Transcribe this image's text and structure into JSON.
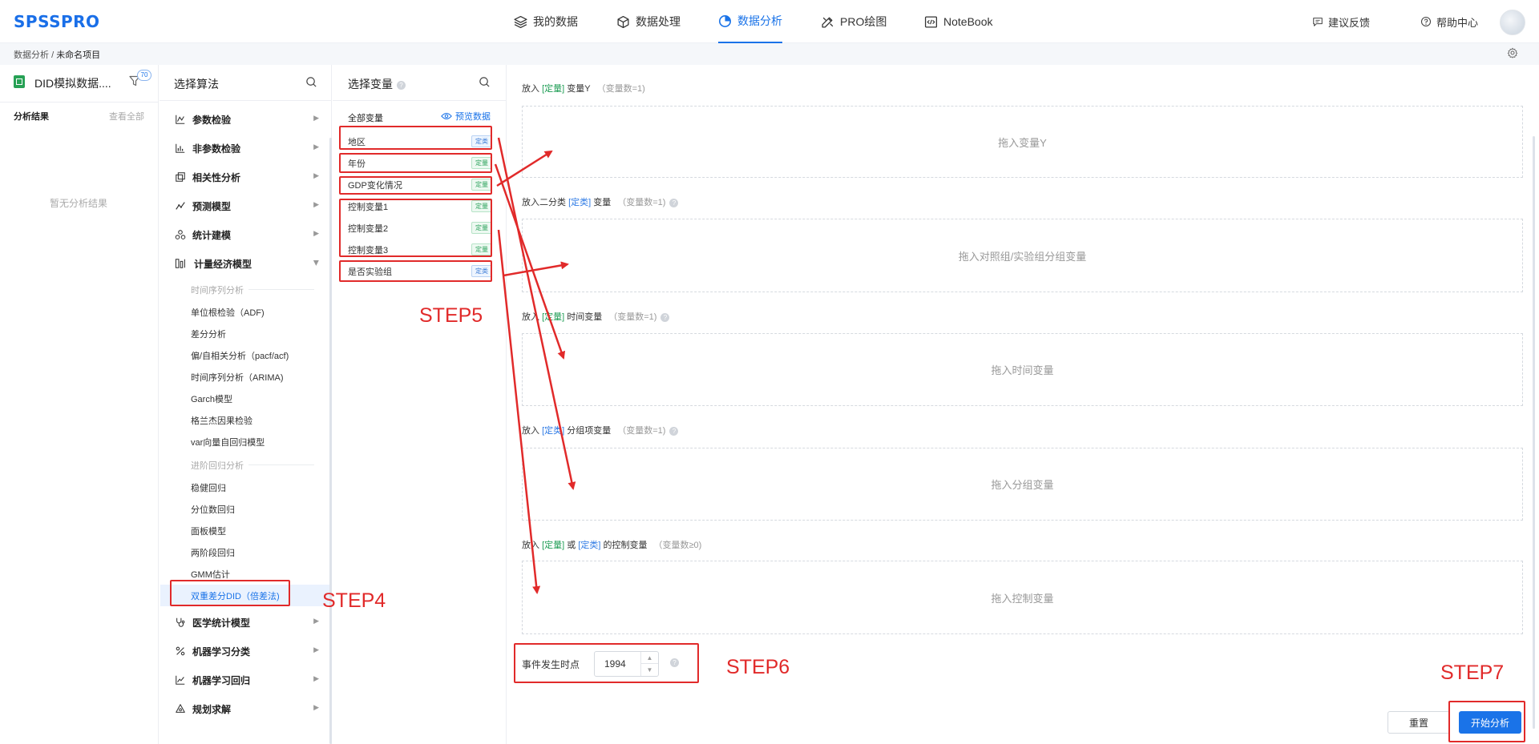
{
  "app": {
    "logo": "SPSSPRO"
  },
  "nav": {
    "items": [
      {
        "label": "我的数据"
      },
      {
        "label": "数据处理"
      },
      {
        "label": "数据分析"
      },
      {
        "label": "PRO绘图"
      },
      {
        "label": "NoteBook"
      }
    ],
    "active": "数据分析",
    "feedback": "建议反馈",
    "help": "帮助中心"
  },
  "breadcrumb": {
    "root": "数据分析",
    "sep": "/",
    "current": "未命名项目"
  },
  "left": {
    "file_title": "DID模拟数据....",
    "filter_badge": "70",
    "results_label": "分析结果",
    "view_all": "查看全部",
    "empty": "暂无分析结果"
  },
  "algo": {
    "title": "选择算法",
    "categories": [
      {
        "label": "参数检验"
      },
      {
        "label": "非参数检验"
      },
      {
        "label": "相关性分析"
      },
      {
        "label": "预测模型"
      },
      {
        "label": "统计建模"
      },
      {
        "label": "计量经济模型"
      },
      {
        "label": "医学统计模型"
      },
      {
        "label": "机器学习分类"
      },
      {
        "label": "机器学习回归"
      },
      {
        "label": "规划求解"
      }
    ],
    "group1_label": "时间序列分析",
    "group1_items": [
      "单位根检验（ADF)",
      "差分分析",
      "偏/自相关分析（pacf/acf)",
      "时间序列分析（ARIMA)",
      "Garch模型",
      "格兰杰因果检验",
      "var向量自回归模型"
    ],
    "group2_label": "进阶回归分析",
    "group2_items": [
      "稳健回归",
      "分位数回归",
      "面板模型",
      "两阶段回归",
      "GMM估计",
      "双重差分DID（倍差法)"
    ]
  },
  "vars": {
    "title": "选择变量",
    "all_label": "全部变量",
    "preview": "预览数据",
    "items": [
      {
        "name": "地区",
        "type": "定类"
      },
      {
        "name": "年份",
        "type": "定量"
      },
      {
        "name": "GDP变化情况",
        "type": "定量"
      },
      {
        "name": "控制变量1",
        "type": "定量"
      },
      {
        "name": "控制变量2",
        "type": "定量"
      },
      {
        "name": "控制变量3",
        "type": "定量"
      },
      {
        "name": "是否实验组",
        "type": "定类"
      }
    ]
  },
  "drops": [
    {
      "pre": "放入",
      "tag": "[定量]",
      "post": " 变量Y",
      "count": "（变量数=1)",
      "placeholder": "拖入变量Y"
    },
    {
      "pre": "放入二分类",
      "tag": "[定类]",
      "post": " 变量",
      "count": "（变量数=1)",
      "placeholder": "拖入对照组/实验组分组变量"
    },
    {
      "pre": "放入",
      "tag": "[定量]",
      "post": " 时间变量",
      "count": "（变量数=1)",
      "placeholder": "拖入时间变量"
    },
    {
      "pre": "放入",
      "tag": "[定类]",
      "post": " 分组项变量",
      "count": "（变量数=1)",
      "placeholder": "拖入分组变量"
    },
    {
      "pre": "放入",
      "tag": "[定量]",
      "mid": " 或 ",
      "tag2": "[定类]",
      "post": " 的控制变量",
      "count": "（变量数≥0)",
      "placeholder": "拖入控制变量"
    }
  ],
  "event": {
    "label": "事件发生时点",
    "value": "1994"
  },
  "buttons": {
    "reset": "重置",
    "start": "开始分析"
  },
  "steps": {
    "s4": "STEP4",
    "s5": "STEP5",
    "s6": "STEP6",
    "s7": "STEP7"
  },
  "colors": {
    "accent": "#1a73e8",
    "annotation": "#e12a2a"
  }
}
